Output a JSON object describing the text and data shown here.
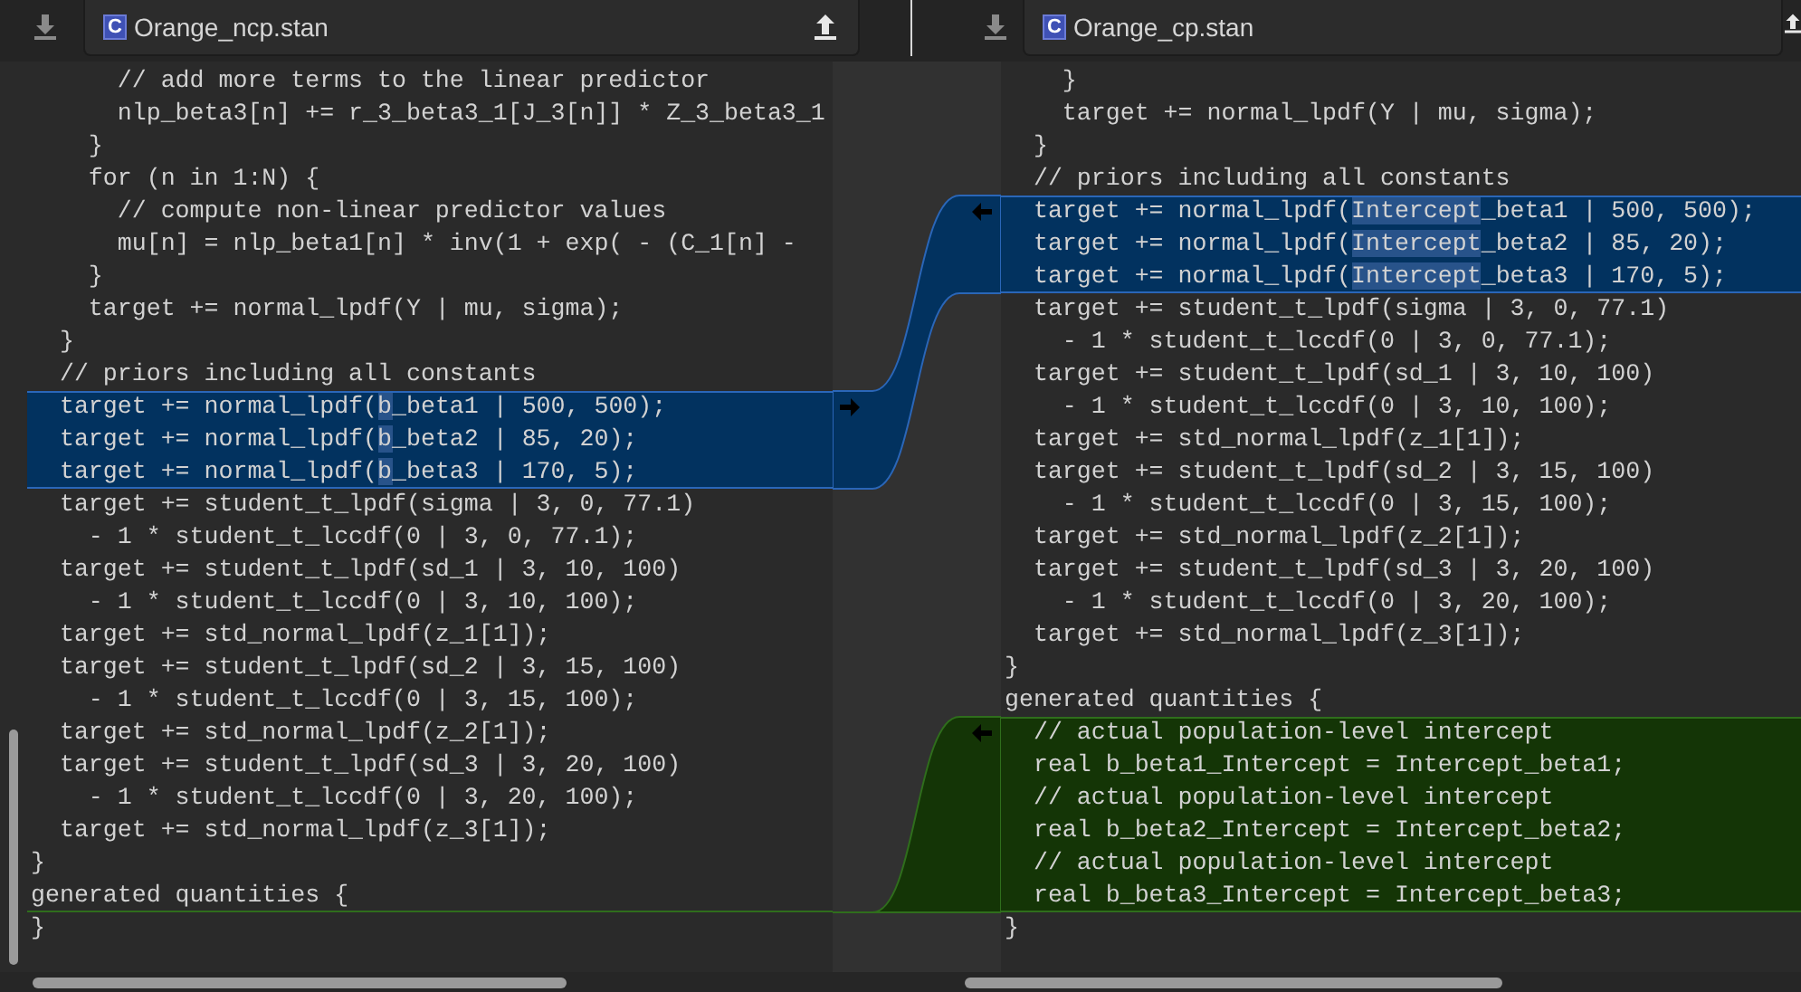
{
  "panes": [
    {
      "file": {
        "badge": "C",
        "name": "Orange_ncp.stan"
      },
      "lines": [
        {
          "kind": "plain",
          "text": "      // add more terms to the linear predictor"
        },
        {
          "kind": "plain",
          "text": "      nlp_beta3[n] += r_3_beta3_1[J_3[n]] * Z_3_beta3_1"
        },
        {
          "kind": "plain",
          "text": "    }"
        },
        {
          "kind": "plain",
          "text": "    for (n in 1:N) {"
        },
        {
          "kind": "plain",
          "text": "      // compute non-linear predictor values"
        },
        {
          "kind": "plain",
          "text": "      mu[n] = nlp_beta1[n] * inv(1 + exp( - (C_1[n] -"
        },
        {
          "kind": "plain",
          "text": "    }"
        },
        {
          "kind": "plain",
          "text": "    target += normal_lpdf(Y | mu, sigma);"
        },
        {
          "kind": "plain",
          "text": "  }"
        },
        {
          "kind": "plain",
          "text": "  // priors including all constants"
        },
        {
          "kind": "changed",
          "parts": [
            {
              "text": "  target += normal_lpdf(",
              "emphasis": false
            },
            {
              "text": "b",
              "emphasis": true
            },
            {
              "text": "_beta1 | 500, 500);",
              "emphasis": false
            }
          ]
        },
        {
          "kind": "changed",
          "parts": [
            {
              "text": "  target += normal_lpdf(",
              "emphasis": false
            },
            {
              "text": "b",
              "emphasis": true
            },
            {
              "text": "_beta2 | 85, 20);",
              "emphasis": false
            }
          ]
        },
        {
          "kind": "changed",
          "parts": [
            {
              "text": "  target += normal_lpdf(",
              "emphasis": false
            },
            {
              "text": "b",
              "emphasis": true
            },
            {
              "text": "_beta3 | 170, 5);",
              "emphasis": false
            }
          ]
        },
        {
          "kind": "plain",
          "text": "  target += student_t_lpdf(sigma | 3, 0, 77.1)"
        },
        {
          "kind": "plain",
          "text": "    - 1 * student_t_lccdf(0 | 3, 0, 77.1);"
        },
        {
          "kind": "plain",
          "text": "  target += student_t_lpdf(sd_1 | 3, 10, 100)"
        },
        {
          "kind": "plain",
          "text": "    - 1 * student_t_lccdf(0 | 3, 10, 100);"
        },
        {
          "kind": "plain",
          "text": "  target += std_normal_lpdf(z_1[1]);"
        },
        {
          "kind": "plain",
          "text": "  target += student_t_lpdf(sd_2 | 3, 15, 100)"
        },
        {
          "kind": "plain",
          "text": "    - 1 * student_t_lccdf(0 | 3, 15, 100);"
        },
        {
          "kind": "plain",
          "text": "  target += std_normal_lpdf(z_2[1]);"
        },
        {
          "kind": "plain",
          "text": "  target += student_t_lpdf(sd_3 | 3, 20, 100)"
        },
        {
          "kind": "plain",
          "text": "    - 1 * student_t_lccdf(0 | 3, 20, 100);"
        },
        {
          "kind": "plain",
          "text": "  target += std_normal_lpdf(z_3[1]);"
        },
        {
          "kind": "plain",
          "text": "}"
        },
        {
          "kind": "plain",
          "text": "generated quantities {",
          "insert_after": true
        },
        {
          "kind": "plain",
          "text": "}"
        }
      ]
    },
    {
      "file": {
        "badge": "C",
        "name": "Orange_cp.stan"
      },
      "lines": [
        {
          "kind": "plain",
          "text": "    }"
        },
        {
          "kind": "plain",
          "text": "    target += normal_lpdf(Y | mu, sigma);"
        },
        {
          "kind": "plain",
          "text": "  }"
        },
        {
          "kind": "plain",
          "text": "  // priors including all constants"
        },
        {
          "kind": "changed",
          "parts": [
            {
              "text": "  target += normal_lpdf(",
              "emphasis": false
            },
            {
              "text": "Intercept",
              "emphasis": true
            },
            {
              "text": "_beta1 | 500, 500);",
              "emphasis": false
            }
          ]
        },
        {
          "kind": "changed",
          "parts": [
            {
              "text": "  target += normal_lpdf(",
              "emphasis": false
            },
            {
              "text": "Intercept",
              "emphasis": true
            },
            {
              "text": "_beta2 | 85, 20);",
              "emphasis": false
            }
          ]
        },
        {
          "kind": "changed",
          "parts": [
            {
              "text": "  target += normal_lpdf(",
              "emphasis": false
            },
            {
              "text": "Intercept",
              "emphasis": true
            },
            {
              "text": "_beta3 | 170, 5);",
              "emphasis": false
            }
          ]
        },
        {
          "kind": "plain",
          "text": "  target += student_t_lpdf(sigma | 3, 0, 77.1)"
        },
        {
          "kind": "plain",
          "text": "    - 1 * student_t_lccdf(0 | 3, 0, 77.1);"
        },
        {
          "kind": "plain",
          "text": "  target += student_t_lpdf(sd_1 | 3, 10, 100)"
        },
        {
          "kind": "plain",
          "text": "    - 1 * student_t_lccdf(0 | 3, 10, 100);"
        },
        {
          "kind": "plain",
          "text": "  target += std_normal_lpdf(z_1[1]);"
        },
        {
          "kind": "plain",
          "text": "  target += student_t_lpdf(sd_2 | 3, 15, 100)"
        },
        {
          "kind": "plain",
          "text": "    - 1 * student_t_lccdf(0 | 3, 15, 100);"
        },
        {
          "kind": "plain",
          "text": "  target += std_normal_lpdf(z_2[1]);"
        },
        {
          "kind": "plain",
          "text": "  target += student_t_lpdf(sd_3 | 3, 20, 100)"
        },
        {
          "kind": "plain",
          "text": "    - 1 * student_t_lccdf(0 | 3, 20, 100);"
        },
        {
          "kind": "plain",
          "text": "  target += std_normal_lpdf(z_3[1]);"
        },
        {
          "kind": "plain",
          "text": "}"
        },
        {
          "kind": "plain",
          "text": "generated quantities {"
        },
        {
          "kind": "inserted",
          "text": "  // actual population-level intercept"
        },
        {
          "kind": "inserted",
          "text": "  real b_beta1_Intercept = Intercept_beta1;"
        },
        {
          "kind": "inserted",
          "text": "  // actual population-level intercept"
        },
        {
          "kind": "inserted",
          "text": "  real b_beta2_Intercept = Intercept_beta2;"
        },
        {
          "kind": "inserted",
          "text": "  // actual population-level intercept"
        },
        {
          "kind": "inserted",
          "text": "  real b_beta3_Intercept = Intercept_beta3;"
        },
        {
          "kind": "plain",
          "text": "}"
        }
      ]
    }
  ]
}
